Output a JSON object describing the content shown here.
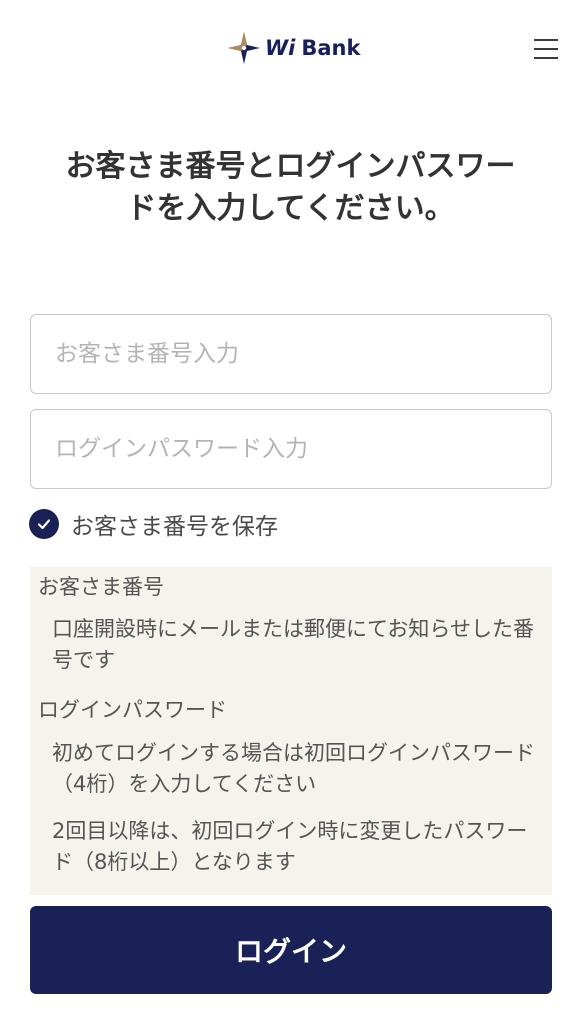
{
  "header": {
    "logo_prefix": "Wi",
    "logo_name": "Bank",
    "brand_color": "#1a1f5c",
    "accent_color": "#b08a5a",
    "menu_icon": "hamburger-menu-icon"
  },
  "title_line1": "お客さま番号とログインパスワー",
  "title_line2": "ドを入力してください。",
  "form": {
    "customer_placeholder": "お客さま番号入力",
    "password_placeholder": "ログインパスワード入力",
    "save_label": "お客さま番号を保存",
    "save_checked": true
  },
  "info": {
    "customer_heading": "お客さま番号",
    "customer_text": "口座開設時にメールまたは郵便にてお知らせした番号です",
    "password_heading": "ログインパスワード",
    "password_text1": "初めてログインする場合は初回ログインパスワード（4桁）を入力してください",
    "password_text2": "2回目以降は、初回ログイン時に変更したパスワード（8桁以上）となります",
    "background_color": "#f6f2ec"
  },
  "login_button": "ログイン",
  "button_color": "#1a2156"
}
